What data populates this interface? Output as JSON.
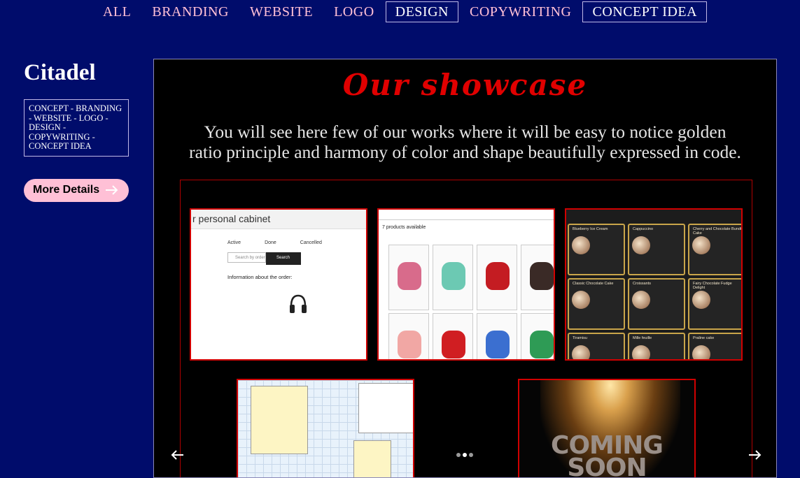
{
  "nav": {
    "items": [
      {
        "label": "ALL",
        "active": false
      },
      {
        "label": "BRANDING",
        "active": false
      },
      {
        "label": "WEBSITE",
        "active": false
      },
      {
        "label": "LOGO",
        "active": false
      },
      {
        "label": "DESIGN",
        "active": true
      },
      {
        "label": "COPYWRITING",
        "active": false
      },
      {
        "label": "CONCEPT IDEA",
        "active": true
      }
    ]
  },
  "sidebar": {
    "title": "Citadel",
    "tags": "CONCEPT - BRANDING - WEBSITE - LOGO - DESIGN - COPYWRITING - CONCEPT IDEA",
    "button_label": "More Details"
  },
  "showcase": {
    "title": "Our showcase",
    "description_line1": "You will see here few of our works where it will be easy to notice golden",
    "description_line2": "ratio principle and harmony of color and shape beautifully expressed in code.",
    "carousel": {
      "current_slide": 2,
      "total_slides": 3
    },
    "thumbs": {
      "cabinet": {
        "header": "r personal cabinet",
        "tabs": [
          "Active",
          "Done",
          "Cancelled"
        ],
        "search_placeholder": "Search by order",
        "search_button": "Search",
        "info_title": "Information about the order:"
      },
      "shop": {
        "title": "7 products available"
      },
      "menu": {
        "items": [
          "Blueberry Ice Cream",
          "Cappuccino",
          "Cherry and Chocolate Bundt Cake",
          "Classic Chocolate Cake",
          "Croissants",
          "Fairy Chocolate Fudge Delight",
          "Tiramisu",
          "Mille feuille",
          "Praline cake"
        ]
      },
      "coming_soon": {
        "line1": "COMING",
        "line2": "SOON"
      }
    }
  },
  "colors": {
    "background": "#000c6b",
    "nav_text": "#ffc0d6",
    "title_red": "#e00000",
    "button_pink": "#ffc0d6"
  }
}
